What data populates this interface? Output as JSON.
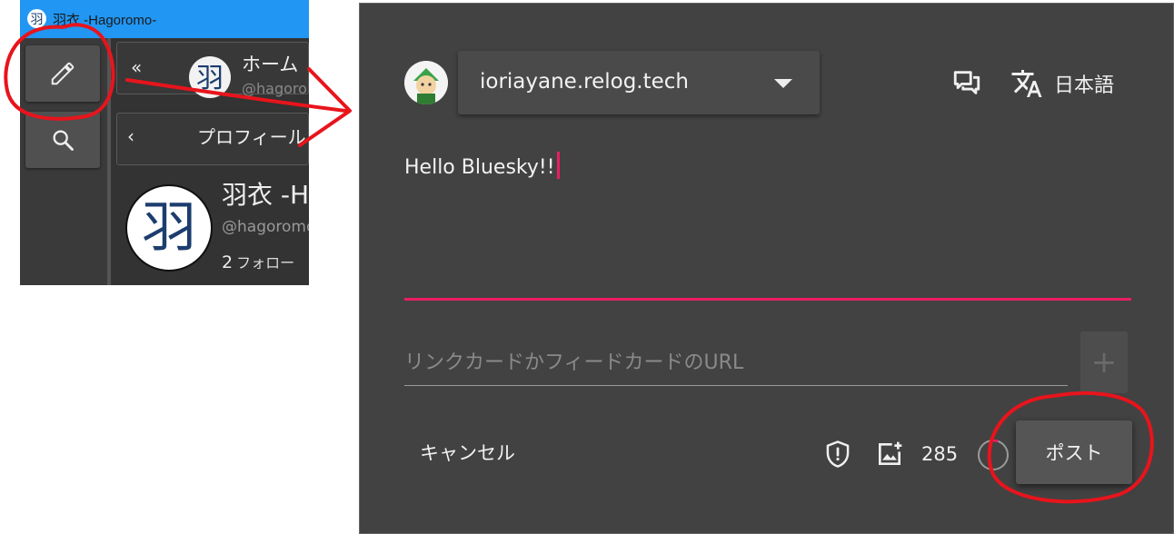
{
  "app_window": {
    "title": "羽衣 -Hagoromo-",
    "home_column": {
      "title": "ホーム",
      "handle": "@hagoro"
    },
    "profile_column": {
      "label": "プロフィール"
    },
    "profile": {
      "name": "羽衣 -H",
      "handle": "@hagoromo",
      "follow_count": "2",
      "follow_label": "フォロー"
    },
    "logo_char": "羽"
  },
  "compose": {
    "account_name": "ioriayane.relog.tech",
    "language_label": "日本語",
    "text": "Hello Bluesky!!",
    "url_placeholder": "リンクカードかフィードカードのURL",
    "add_label": "+",
    "cancel_label": "キャンセル",
    "char_count": "285",
    "post_label": "ポスト"
  },
  "colors": {
    "accent": "#e91e63",
    "titlebar": "#2196f3",
    "annotation": "#e8141c",
    "dialog_bg": "#424242"
  },
  "icons": [
    "threads-icon",
    "translate-icon",
    "shield-icon",
    "image-icon",
    "pencil-icon",
    "search-icon"
  ]
}
